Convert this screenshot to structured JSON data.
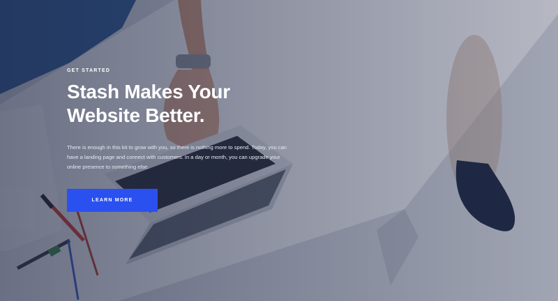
{
  "hero": {
    "eyebrow": "GET STARTED",
    "title_line1": "Stash Makes Your",
    "title_line2": "Website Better.",
    "subtitle": "There is enough in this kit to grow with you, so there is nothing more to spend. Today, you can have a landing page and connect with customers. In a day or month, you can upgrade your online presence to something else.",
    "cta_label": "LEARN MORE"
  },
  "colors": {
    "accent": "#2a50f0",
    "overlay": "#1c2442"
  },
  "background": {
    "photo": "desk-with-laptop-and-papers"
  }
}
